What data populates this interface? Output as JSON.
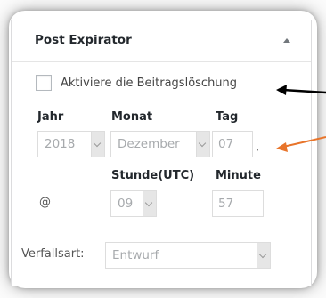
{
  "metabox": {
    "title": "Post Expirator",
    "enable_label": "Aktiviere die Beitragslöschung",
    "headers": {
      "year": "Jahr",
      "month": "Monat",
      "day": "Tag",
      "hour": "Stunde(UTC)",
      "minute": "Minute"
    },
    "values": {
      "year": "2018",
      "month": "Dezember",
      "day": "07",
      "hour": "09",
      "minute": "57"
    },
    "comma": ",",
    "at_sign": "@",
    "expiry_type_label": "Verfallsart:",
    "expiry_type_value": "Entwurf"
  },
  "colors": {
    "arrow_black": "#000000",
    "arrow_orange": "#e8742a",
    "disabled_text": "#a7aaad"
  },
  "icons": {
    "collapse": "triangle-up-icon",
    "dropdown": "chevron-down-icon"
  }
}
